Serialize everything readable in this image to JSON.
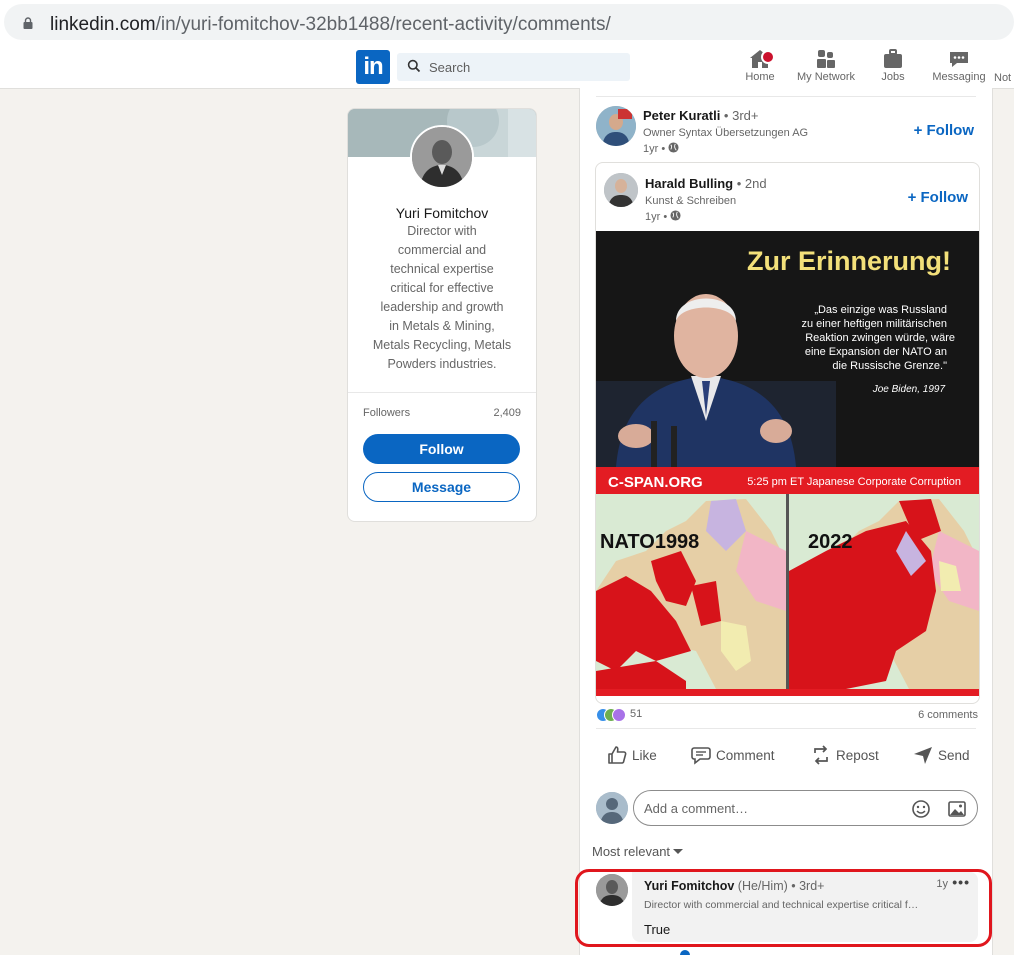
{
  "browser": {
    "url_domain": "linkedin.com",
    "url_path": "/in/yuri-fomitchov-32bb1488/recent-activity/comments/"
  },
  "nav": {
    "search_placeholder": "Search",
    "items": [
      {
        "label": "Home",
        "icon": "home-icon"
      },
      {
        "label": "My Network",
        "icon": "people-icon"
      },
      {
        "label": "Jobs",
        "icon": "briefcase-icon"
      },
      {
        "label": "Messaging",
        "icon": "messaging-icon"
      },
      {
        "label": "Not",
        "icon": "bell-icon"
      }
    ],
    "home_has_notification": true
  },
  "profile": {
    "name": "Yuri Fomitchov",
    "headline_lines": [
      "Director with",
      "commercial and",
      "technical expertise",
      "critical for effective",
      "leadership and growth",
      "in Metals & Mining,",
      "Metals Recycling, Metals",
      "Powders industries."
    ],
    "followers_label": "Followers",
    "followers_count": "2,409",
    "follow_label": "Follow",
    "message_label": "Message"
  },
  "post": {
    "actor": {
      "name": "Peter Kuratli",
      "degree": " • 3rd+",
      "subtitle": "Owner Syntax Übersetzungen AG",
      "time": "1yr •",
      "follow_label": "+ Follow"
    },
    "reshared": {
      "name": "Harald Bulling",
      "degree": " • 2nd",
      "subtitle": "Kunst & Schreiben",
      "time": "1yr •",
      "follow_label": "+ Follow"
    },
    "image": {
      "headline": "Zur Erinnerung!",
      "quote_lines": [
        "„Das einzige was Russland",
        "zu einer heftigen militärischen",
        "Reaktion zwingen würde, wäre",
        "eine Expansion der NATO an",
        "die Russische Grenze.\""
      ],
      "quote_author": "Joe Biden, 1997",
      "banner_left": "C-SPAN.ORG",
      "banner_right": "5:25 pm ET Japanese Corporate Corruption",
      "map_left_label": "NATO1998",
      "map_right_label": "2022"
    },
    "reactions_count": "51",
    "comments_count": "6 comments",
    "actions": [
      "Like",
      "Comment",
      "Repost",
      "Send"
    ],
    "comment_placeholder": "Add a comment…",
    "sort_label": "Most relevant"
  },
  "comment": {
    "name": "Yuri Fomitchov",
    "pronouns": "(He/Him)",
    "degree": " • 3rd+",
    "time": "1y",
    "headline": "Director with commercial and technical expertise critical for effective leadership and growth",
    "text": "True"
  },
  "colors": {
    "brand": "#0a66c2",
    "highlight": "#e0161d",
    "cspan_red": "#e31c23",
    "nato_red": "#d7131a",
    "headline_yellow": "#f3e07a"
  }
}
